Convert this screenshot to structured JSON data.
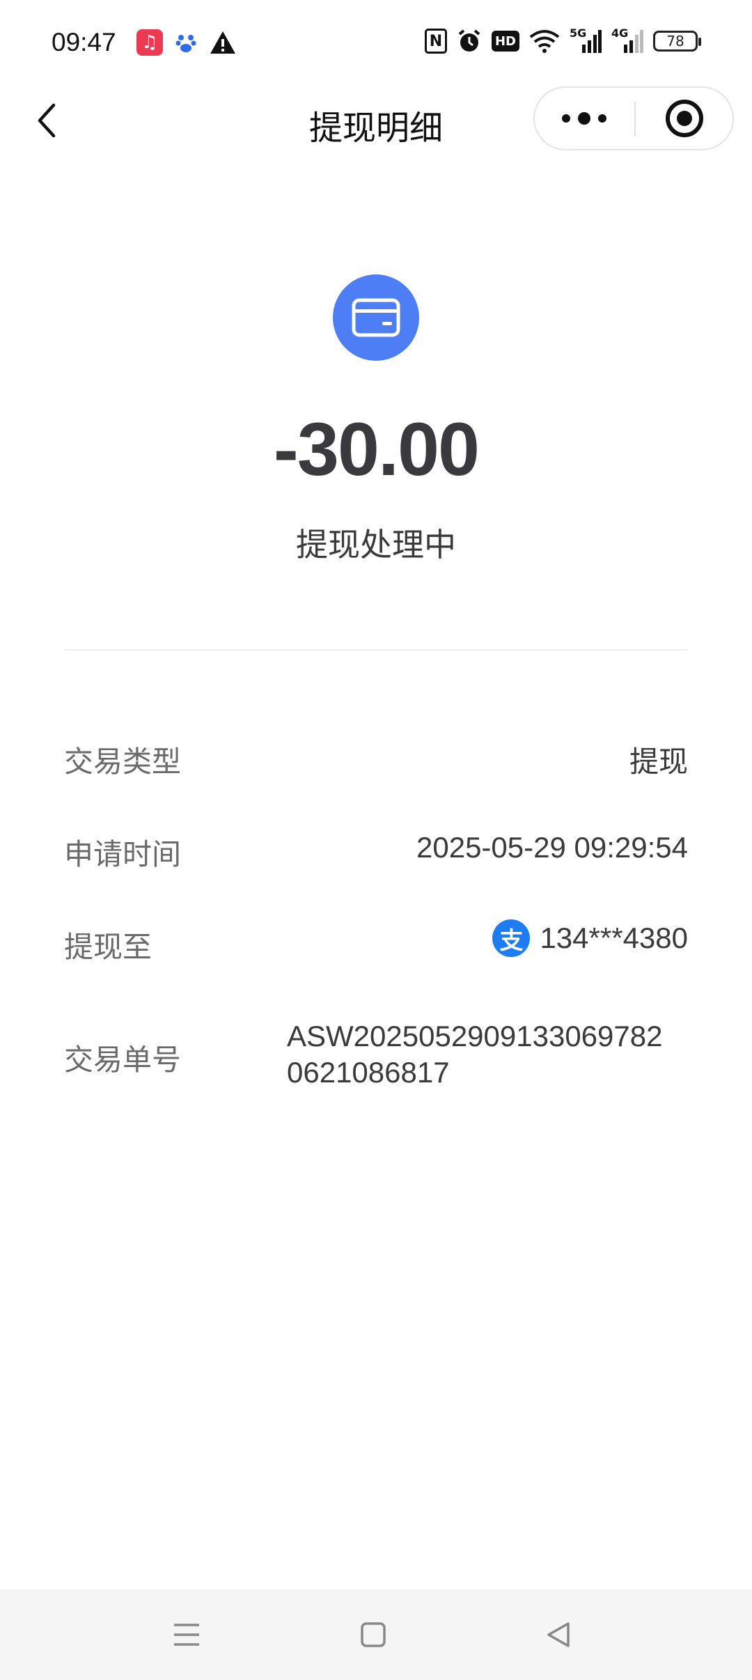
{
  "status_bar": {
    "time": "09:47",
    "left_icons": [
      "music-icon",
      "baidu-icon",
      "warning-icon"
    ],
    "right_icons": [
      "nfc-icon",
      "alarm-icon",
      "hd-icon",
      "wifi-icon",
      "signal-5g-icon",
      "signal-4g-icon",
      "battery-icon"
    ],
    "hd_label": "HD",
    "net_5g": "5G",
    "net_4g": "4G",
    "battery_level": "78"
  },
  "nav": {
    "title": "提现明细",
    "back_icon": "chevron-left-icon",
    "more_icon": "more-dots-icon",
    "close_icon": "target-circle-icon"
  },
  "summary": {
    "icon": "card-icon",
    "icon_color": "#4d7ef6",
    "amount": "-30.00",
    "status": "提现处理中"
  },
  "details": {
    "type_label": "交易类型",
    "type_value": "提现",
    "time_label": "申请时间",
    "time_value": "2025-05-29 09:29:54",
    "to_label": "提现至",
    "to_icon": "alipay-icon",
    "to_icon_color": "#1d7cf2",
    "to_value": "134***4380",
    "order_label": "交易单号",
    "order_value": "ASW20250529091330697820621086817"
  },
  "system_nav": {
    "icons": [
      "menu-icon",
      "home-square-icon",
      "back-triangle-icon"
    ]
  }
}
